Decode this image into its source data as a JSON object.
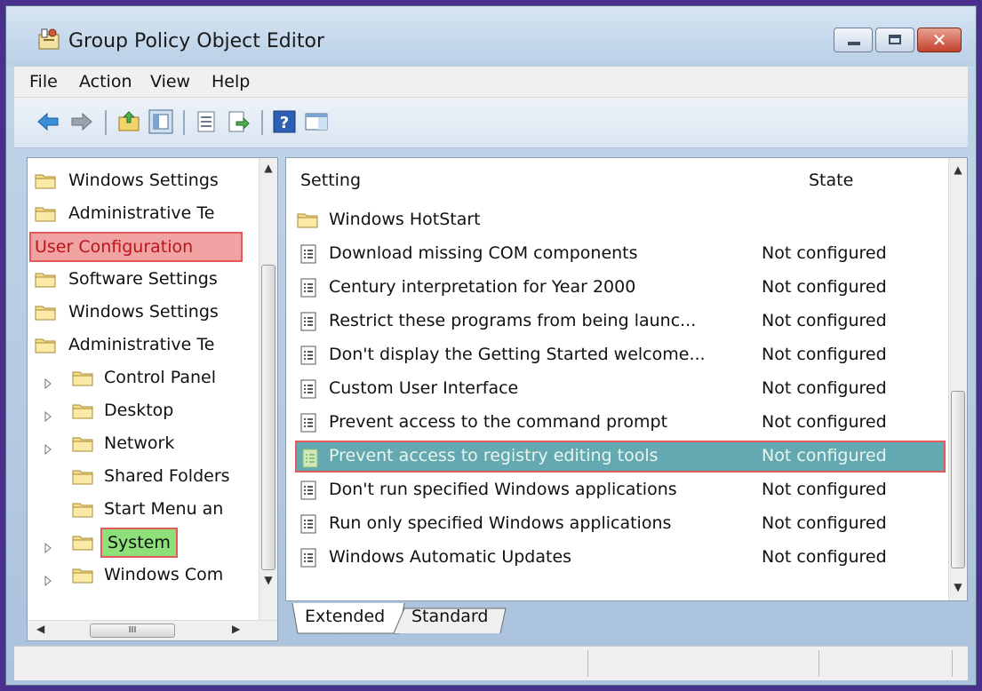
{
  "window": {
    "title": "Group Policy Object Editor"
  },
  "menu": [
    "File",
    "Action",
    "View",
    "Help"
  ],
  "tree": {
    "items": [
      {
        "label": "Windows Settings",
        "indent": 0,
        "expander": false
      },
      {
        "label": "Administrative Te",
        "indent": 0,
        "expander": false
      },
      {
        "label": "User Configuration",
        "indent": 0,
        "expander": false,
        "highlight": "red",
        "no_folder": true
      },
      {
        "label": "Software Settings",
        "indent": 0,
        "expander": false
      },
      {
        "label": "Windows Settings",
        "indent": 0,
        "expander": false
      },
      {
        "label": "Administrative Te",
        "indent": 0,
        "expander": false
      },
      {
        "label": "Control Panel",
        "indent": 1,
        "expander": true
      },
      {
        "label": "Desktop",
        "indent": 1,
        "expander": true
      },
      {
        "label": "Network",
        "indent": 1,
        "expander": true
      },
      {
        "label": "Shared Folders",
        "indent": 1,
        "expander": false
      },
      {
        "label": "Start Menu an",
        "indent": 1,
        "expander": false
      },
      {
        "label": "System",
        "indent": 1,
        "expander": true,
        "highlight": "green"
      },
      {
        "label": "Windows Com",
        "indent": 1,
        "expander": true
      }
    ],
    "hscroll_grip": "III"
  },
  "list": {
    "columns": {
      "setting": "Setting",
      "state": "State"
    },
    "rows": [
      {
        "name": "Windows HotStart",
        "state": "",
        "icon": "folder"
      },
      {
        "name": "Download missing COM components",
        "state": "Not configured",
        "icon": "doc"
      },
      {
        "name": "Century interpretation for Year 2000",
        "state": "Not configured",
        "icon": "doc"
      },
      {
        "name": "Restrict these programs from being launc...",
        "state": "Not configured",
        "icon": "doc"
      },
      {
        "name": "Don't display the Getting Started welcome...",
        "state": "Not configured",
        "icon": "doc"
      },
      {
        "name": "Custom User Interface",
        "state": "Not configured",
        "icon": "doc"
      },
      {
        "name": "Prevent access to the command prompt",
        "state": "Not configured",
        "icon": "doc"
      },
      {
        "name": "Prevent access to registry editing tools",
        "state": "Not configured",
        "icon": "doc",
        "selected": true
      },
      {
        "name": "Don't run specified Windows applications",
        "state": "Not configured",
        "icon": "doc"
      },
      {
        "name": "Run only specified Windows applications",
        "state": "Not configured",
        "icon": "doc"
      },
      {
        "name": "Windows Automatic Updates",
        "state": "Not configured",
        "icon": "doc"
      }
    ]
  },
  "tabs": [
    "Extended",
    "Standard"
  ],
  "colors": {
    "selected_row": "#64a9b1",
    "highlight_border": "#e35a5a",
    "highlight_green": "#8de07a",
    "highlight_red": "#f1a3a3"
  }
}
